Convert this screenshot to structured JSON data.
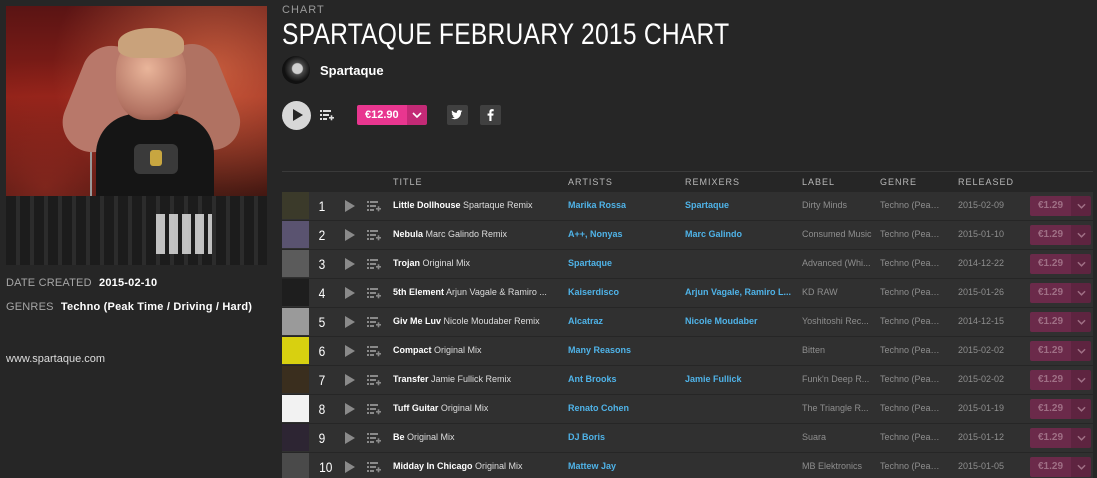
{
  "chart": {
    "kicker": "CHART",
    "title": "SPARTAQUE FEBRUARY 2015 CHART",
    "artist": "Spartaque",
    "price": "€12.90",
    "share_twitter_icon": "twitter-icon",
    "share_facebook_icon": "facebook-icon"
  },
  "meta": {
    "date_label": "DATE CREATED",
    "date_value": "2015-02-10",
    "genres_label": "GENRES",
    "genres_value": "Techno (Peak Time / Driving / Hard)",
    "website": "www.spartaque.com"
  },
  "table": {
    "headers": {
      "title": "TITLE",
      "artists": "ARTISTS",
      "remixers": "REMIXERS",
      "label": "LABEL",
      "genre": "GENRE",
      "released": "RELEASED"
    },
    "rows": [
      {
        "num": "1",
        "name": "Little Dollhouse",
        "mix": "Spartaque Remix",
        "artists": "Marika Rossa",
        "remixers": "Spartaque",
        "label": "Dirty Minds",
        "genre": "Techno (Peak ...",
        "released": "2015-02-09",
        "price": "€1.29",
        "thumb": "#3b3a2a"
      },
      {
        "num": "2",
        "name": "Nebula",
        "mix": "Marc Galindo Remix",
        "artists": "A++, Nonyas",
        "remixers": "Marc Galindo",
        "label": "Consumed Music",
        "genre": "Techno (Peak ...",
        "released": "2015-01-10",
        "price": "€1.29",
        "thumb": "#5a5370"
      },
      {
        "num": "3",
        "name": "Trojan",
        "mix": "Original Mix",
        "artists": "Spartaque",
        "remixers": "",
        "label": "Advanced (Whi...",
        "genre": "Techno (Peak ...",
        "released": "2014-12-22",
        "price": "€1.29",
        "thumb": "#5b5b5b"
      },
      {
        "num": "4",
        "name": "5th Element",
        "mix": "Arjun Vagale & Ramiro ...",
        "artists": "Kaiserdisco",
        "remixers": "Arjun Vagale, Ramiro L...",
        "label": "KD RAW",
        "genre": "Techno (Peak ...",
        "released": "2015-01-26",
        "price": "€1.29",
        "thumb": "#1e1e1e"
      },
      {
        "num": "5",
        "name": "Giv Me Luv",
        "mix": "Nicole Moudaber Remix",
        "artists": "Alcatraz",
        "remixers": "Nicole Moudaber",
        "label": "Yoshitoshi Rec...",
        "genre": "Techno (Peak ...",
        "released": "2014-12-15",
        "price": "€1.29",
        "thumb": "#9a9a9a"
      },
      {
        "num": "6",
        "name": "Compact",
        "mix": "Original Mix",
        "artists": "Many Reasons",
        "remixers": "",
        "label": "Bitten",
        "genre": "Techno (Peak ...",
        "released": "2015-02-02",
        "price": "€1.29",
        "thumb": "#d8d010"
      },
      {
        "num": "7",
        "name": "Transfer",
        "mix": "Jamie Fullick Remix",
        "artists": "Ant Brooks",
        "remixers": "Jamie Fullick",
        "label": "Funk'n Deep R...",
        "genre": "Techno (Peak ...",
        "released": "2015-02-02",
        "price": "€1.29",
        "thumb": "#3a2e1e"
      },
      {
        "num": "8",
        "name": "Tuff Guitar",
        "mix": "Original Mix",
        "artists": "Renato Cohen",
        "remixers": "",
        "label": "The Triangle R...",
        "genre": "Techno (Peak ...",
        "released": "2015-01-19",
        "price": "€1.29",
        "thumb": "#f2f2f2"
      },
      {
        "num": "9",
        "name": "Be",
        "mix": "Original Mix",
        "artists": "DJ Boris",
        "remixers": "",
        "label": "Suara",
        "genre": "Techno (Peak ...",
        "released": "2015-01-12",
        "price": "€1.29",
        "thumb": "#2d2533"
      },
      {
        "num": "10",
        "name": "Midday In Chicago",
        "mix": "Original Mix",
        "artists": "Mattew Jay",
        "remixers": "",
        "label": "MB Elektronics",
        "genre": "Techno (Peak ...",
        "released": "2015-01-05",
        "price": "€1.29",
        "thumb": "#4a4a4a"
      }
    ]
  }
}
